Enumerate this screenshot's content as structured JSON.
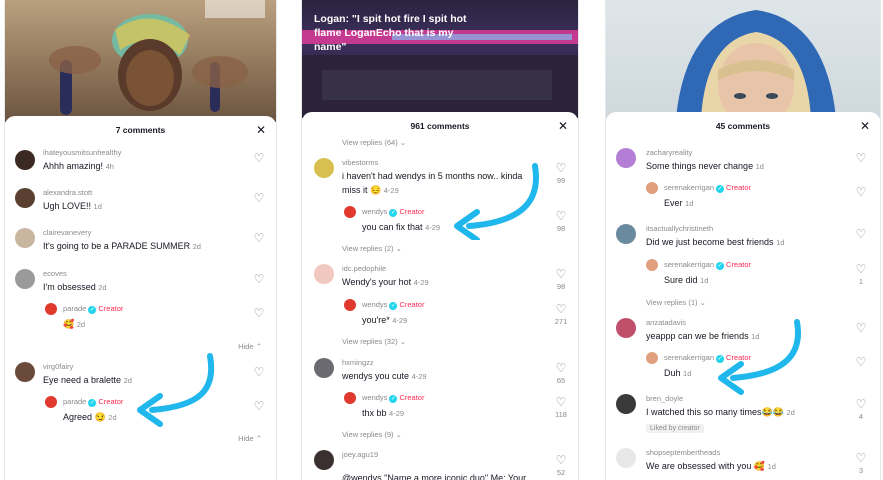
{
  "panels": [
    {
      "comment_count": "7 comments",
      "comments": [
        {
          "user": "ihateyousmitsunhealthy",
          "text": "Ahhh amazing!",
          "time": "4h"
        },
        {
          "user": "alexandra.stott",
          "text": "Ugh LOVE!!",
          "time": "1d"
        },
        {
          "user": "clairevanevery",
          "text": "It's going to be a PARADE SUMMER",
          "time": "2d"
        },
        {
          "user": "ecoves",
          "text": "I'm obsessed",
          "time": "2d"
        },
        {
          "user": "parade",
          "badge": "Creator",
          "text": "🥰",
          "time": "2d"
        },
        {
          "user": "virg0fairy",
          "text": "Eye need a bralette",
          "time": "2d"
        },
        {
          "user": "parade",
          "badge": "Creator",
          "text": "Agreed 😏",
          "time": "2d"
        }
      ],
      "hide_label": "Hide"
    },
    {
      "caption": "Logan: \"I spit hot fire I spit hot flame LoganEcho that is my name\"",
      "comment_count": "961 comments",
      "view_replies_64": "View replies (64)",
      "view_replies_2": "View replies (2)",
      "view_replies_32": "View replies (32)",
      "view_replies_9": "View replies (9)",
      "comments": [
        {
          "user": "vibestorms",
          "text": "i haven't had wendys in 5 months now.. kinda",
          "text2": "miss it 😔",
          "time": "4-29",
          "likes": "99"
        },
        {
          "user": "wendys",
          "badge": "Creator",
          "text": "you can fix that",
          "time": "4-29",
          "likes": "98"
        },
        {
          "user": "idc.pedophile",
          "text": "Wendy's your hot",
          "time": "4-29",
          "likes": "98"
        },
        {
          "user": "wendys",
          "badge": "Creator",
          "text": "you're*",
          "time": "4-29",
          "likes": "271"
        },
        {
          "user": "hxmingzz",
          "text": "wendys you cute",
          "time": "4-29",
          "likes": "65"
        },
        {
          "user": "wendys",
          "badge": "Creator",
          "text": "thx bb",
          "time": "4-29",
          "likes": "118"
        },
        {
          "user": "joey.agu19",
          "text": "@wendys \"Name a more iconic duo\" Me: Your",
          "likes": "52"
        }
      ]
    },
    {
      "comment_count": "45 comments",
      "view_replies_1": "View replies (1)",
      "liked_by_creator": "Liked by creator",
      "comments": [
        {
          "user": "zacharyreality",
          "text": "Some things never change",
          "time": "1d"
        },
        {
          "user": "serenakerrigan",
          "badge": "Creator",
          "text": "Ever",
          "time": "1d"
        },
        {
          "user": "itsactuallychristineth",
          "text": "Did we just become best friends",
          "time": "1d"
        },
        {
          "user": "serenakerrigan",
          "badge": "Creator",
          "text": "Sure did",
          "time": "1d",
          "likes": "1"
        },
        {
          "user": "anzatadavis",
          "text": "yeappp can we be friends",
          "time": "1d"
        },
        {
          "user": "serenakerrigan",
          "badge": "Creator",
          "text": "Duh",
          "time": "1d"
        },
        {
          "user": "bren_doyle",
          "text": "I watched this so many times😂😂",
          "time": "2d",
          "likes": "4"
        },
        {
          "user": "shopseptembertheads",
          "text": "We are obsessed with you 🥰",
          "time": "1d",
          "likes": "3"
        }
      ]
    }
  ],
  "icons": {
    "heart": "heart-outline-icon",
    "close": "close-icon",
    "check": "verified-check-icon",
    "chevron": "chevron-icon"
  },
  "colors": {
    "creator": "#fe2c55",
    "verified": "#20d5ec",
    "arrow": "#20b7ec"
  }
}
